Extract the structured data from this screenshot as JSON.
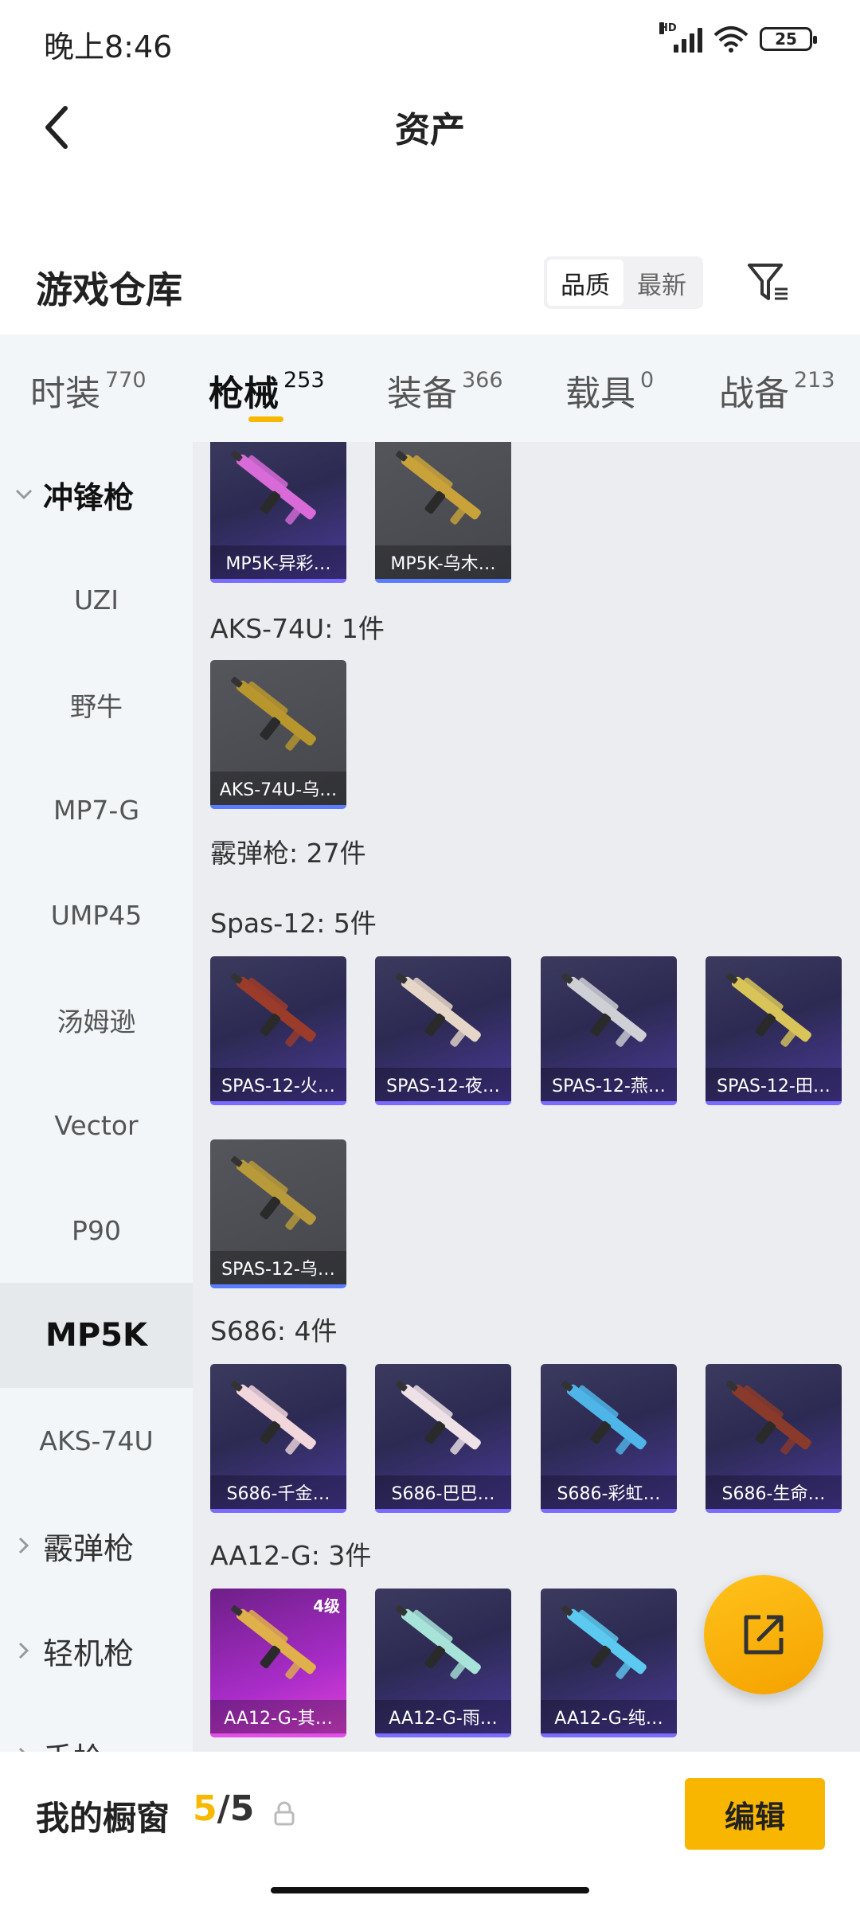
{
  "status": {
    "time": "晚上8:46",
    "battery": "25",
    "network": "HD"
  },
  "nav": {
    "title": "资产"
  },
  "warehouse": {
    "title": "游戏仓库",
    "sort_options": [
      "品质",
      "最新"
    ],
    "active_sort": "品质"
  },
  "tabs": [
    {
      "label": "时装",
      "count": "770"
    },
    {
      "label": "枪械",
      "count": "253",
      "active": true
    },
    {
      "label": "装备",
      "count": "366"
    },
    {
      "label": "载具",
      "count": "0"
    },
    {
      "label": "战备",
      "count": "213"
    }
  ],
  "sidebar": {
    "items": [
      {
        "label": "冲锋枪",
        "type": "group",
        "open": true
      },
      {
        "label": "UZI"
      },
      {
        "label": "野牛"
      },
      {
        "label": "MP7-G"
      },
      {
        "label": "UMP45"
      },
      {
        "label": "汤姆逊"
      },
      {
        "label": "Vector"
      },
      {
        "label": "P90"
      },
      {
        "label": "MP5K",
        "active": true
      },
      {
        "label": "AKS-74U"
      },
      {
        "label": "霰弹枪",
        "type": "group"
      },
      {
        "label": "轻机枪",
        "type": "group"
      },
      {
        "label": "手枪",
        "type": "group"
      }
    ]
  },
  "content": {
    "groups": [
      {
        "title": "AKS-74U: 1件"
      },
      {
        "title": "霰弹枪: 27件"
      },
      {
        "title": "Spas-12: 5件"
      },
      {
        "title": "S686: 4件"
      },
      {
        "title": "AA12-G: 3件"
      }
    ],
    "cards": [
      {
        "label": "MP5K-异彩…",
        "style": "purple",
        "weapon_color": "#d86bd8"
      },
      {
        "label": "MP5K-乌木…",
        "style": "gray",
        "weapon_color": "#c9a23a"
      },
      {
        "label": "AKS-74U-乌…",
        "style": "gray",
        "weapon_color": "#b8962e"
      },
      {
        "label": "SPAS-12-火…",
        "style": "purple",
        "weapon_color": "#9b3b2a"
      },
      {
        "label": "SPAS-12-夜…",
        "style": "purple",
        "weapon_color": "#e6d6c8"
      },
      {
        "label": "SPAS-12-燕…",
        "style": "purple",
        "weapon_color": "#cfcfd6"
      },
      {
        "label": "SPAS-12-田…",
        "style": "purple",
        "weapon_color": "#d9c45a"
      },
      {
        "label": "SPAS-12-乌…",
        "style": "gray",
        "weapon_color": "#b99a3a"
      },
      {
        "label": "S686-千金…",
        "style": "purple",
        "weapon_color": "#f1d6dc"
      },
      {
        "label": "S686-巴巴…",
        "style": "purple",
        "weapon_color": "#efe2e6"
      },
      {
        "label": "S686-彩虹…",
        "style": "purple",
        "weapon_color": "#4fb5e8"
      },
      {
        "label": "S686-生命…",
        "style": "purple",
        "weapon_color": "#8a3a2a"
      },
      {
        "label": "AA12-G-其…",
        "style": "pink",
        "weapon_color": "#e0b04a",
        "badge": "4级"
      },
      {
        "label": "AA12-G-雨…",
        "style": "purple",
        "weapon_color": "#a7e3d8"
      },
      {
        "label": "AA12-G-纯…",
        "style": "purple",
        "weapon_color": "#5cc9f0"
      }
    ]
  },
  "bottom": {
    "showcase_label": "我的橱窗",
    "showcase_current": "5",
    "showcase_total": "/5",
    "edit_label": "编辑"
  },
  "colors": {
    "accent": "#f6b900",
    "edit_button": "#f8b600"
  }
}
